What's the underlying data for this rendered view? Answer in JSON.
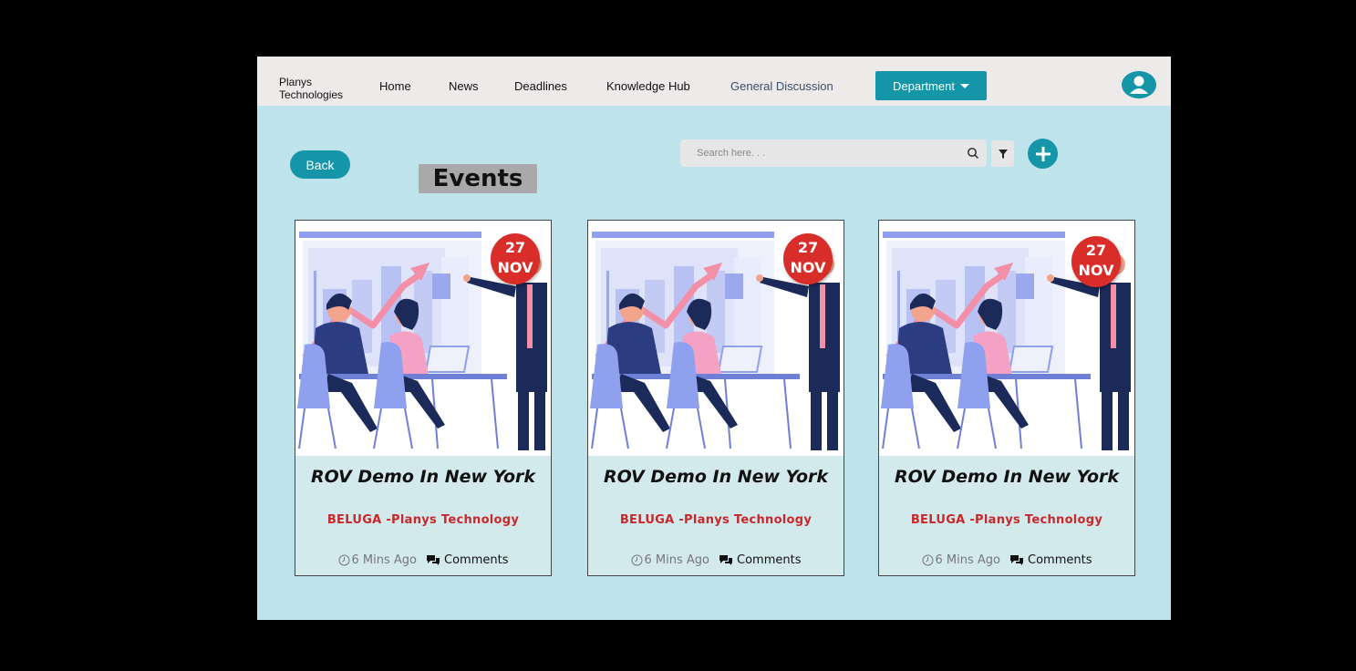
{
  "header": {
    "brand_line1": "Planys",
    "brand_line2": "Technologies",
    "nav": [
      "Home",
      "News",
      "Deadlines",
      "Knowledge Hub",
      "General Discussion"
    ],
    "department_label": "Department"
  },
  "toolbar": {
    "back_label": "Back",
    "page_title": "Events",
    "search_placeholder": "Search here. . ."
  },
  "colors": {
    "accent": "#1595a8",
    "badge": "#d92d2a",
    "org_text": "#c8282b",
    "panel": "#bfe3ea"
  },
  "icons": [
    "user-icon",
    "search-icon",
    "filter-icon",
    "plus-icon",
    "clock-icon",
    "comments-icon"
  ],
  "events": [
    {
      "day": "27",
      "month": "NOV",
      "title": "ROV Demo In New York",
      "org": "BELUGA -Planys Technology",
      "time": "6 Mins Ago",
      "comments": "Comments"
    },
    {
      "day": "27",
      "month": "NOV",
      "title": "ROV Demo In New York",
      "org": "BELUGA -Planys Technology",
      "time": "6 Mins Ago",
      "comments": "Comments"
    },
    {
      "day": "27",
      "month": "NOV",
      "title": "ROV Demo In New York",
      "org": "BELUGA -Planys Technology",
      "time": "6 Mins Ago",
      "comments": "Comments"
    }
  ]
}
